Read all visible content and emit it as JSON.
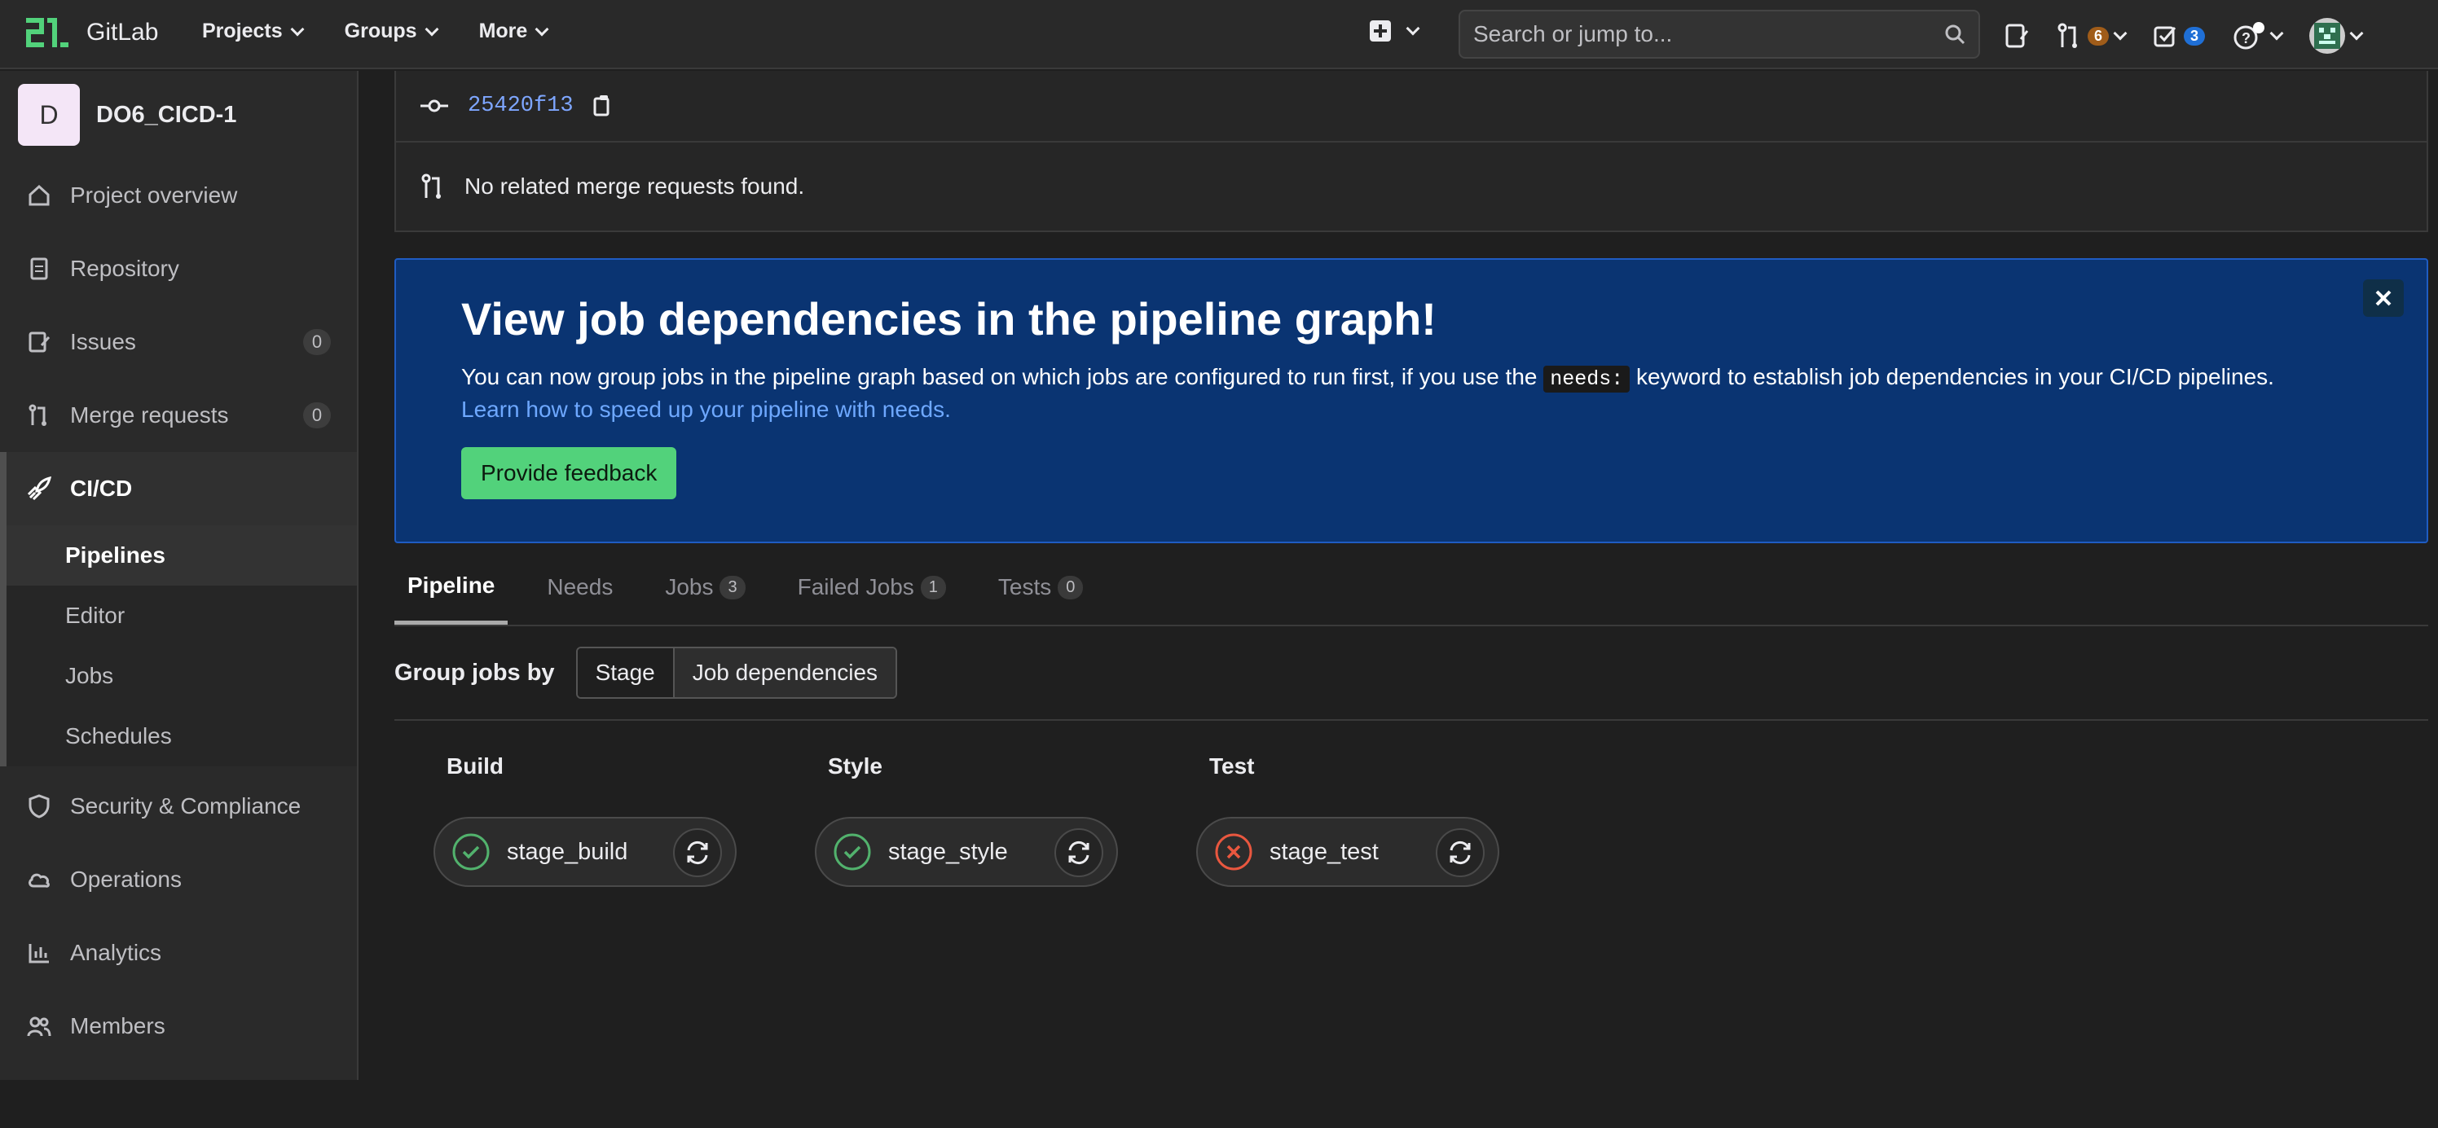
{
  "topbar": {
    "logo_text": "GitLab",
    "nav": [
      {
        "label": "Projects"
      },
      {
        "label": "Groups"
      },
      {
        "label": "More"
      }
    ],
    "search_placeholder": "Search or jump to...",
    "merge_requests_count": "6",
    "todos_count": "3",
    "colors": {
      "mr_badge": "#a05c19",
      "todo_badge": "#1f6fd6"
    }
  },
  "sidebar": {
    "project_initial": "D",
    "project_name": "DO6_CICD-1",
    "items": [
      {
        "label": "Project overview",
        "icon": "home-icon"
      },
      {
        "label": "Repository",
        "icon": "document-icon"
      },
      {
        "label": "Issues",
        "icon": "issues-icon",
        "count": "0"
      },
      {
        "label": "Merge requests",
        "icon": "merge-request-icon",
        "count": "0"
      },
      {
        "label": "CI/CD",
        "icon": "rocket-icon"
      }
    ],
    "cicd_sub": [
      {
        "label": "Pipelines"
      },
      {
        "label": "Editor"
      },
      {
        "label": "Jobs"
      },
      {
        "label": "Schedules"
      }
    ],
    "items_after": [
      {
        "label": "Security & Compliance",
        "icon": "shield-icon"
      },
      {
        "label": "Operations",
        "icon": "cloud-icon"
      },
      {
        "label": "Analytics",
        "icon": "chart-icon"
      },
      {
        "label": "Members",
        "icon": "users-icon"
      }
    ]
  },
  "commit": {
    "sha": "25420f13",
    "no_mr_text": "No related merge requests found."
  },
  "banner": {
    "title": "View job dependencies in the pipeline graph!",
    "text_before": "You can now group jobs in the pipeline graph based on which jobs are configured to run first, if you use the ",
    "code": "needs:",
    "text_after": " keyword to establish job dependencies in your CI/CD pipelines.",
    "link": "Learn how to speed up your pipeline with needs.",
    "button": "Provide feedback"
  },
  "tabs": [
    {
      "label": "Pipeline"
    },
    {
      "label": "Needs"
    },
    {
      "label": "Jobs",
      "count": "3"
    },
    {
      "label": "Failed Jobs",
      "count": "1"
    },
    {
      "label": "Tests",
      "count": "0"
    }
  ],
  "group_by": {
    "label": "Group jobs by",
    "options": [
      "Stage",
      "Job dependencies"
    ],
    "selected": "Stage"
  },
  "stages": [
    {
      "name": "Build",
      "job": "stage_build",
      "status": "success"
    },
    {
      "name": "Style",
      "job": "stage_style",
      "status": "success"
    },
    {
      "name": "Test",
      "job": "stage_test",
      "status": "failed"
    }
  ],
  "colors": {
    "success": "#52b26d",
    "failed": "#e9573f",
    "banner_bg": "#0a3472",
    "feedback_button": "#52d27b"
  }
}
